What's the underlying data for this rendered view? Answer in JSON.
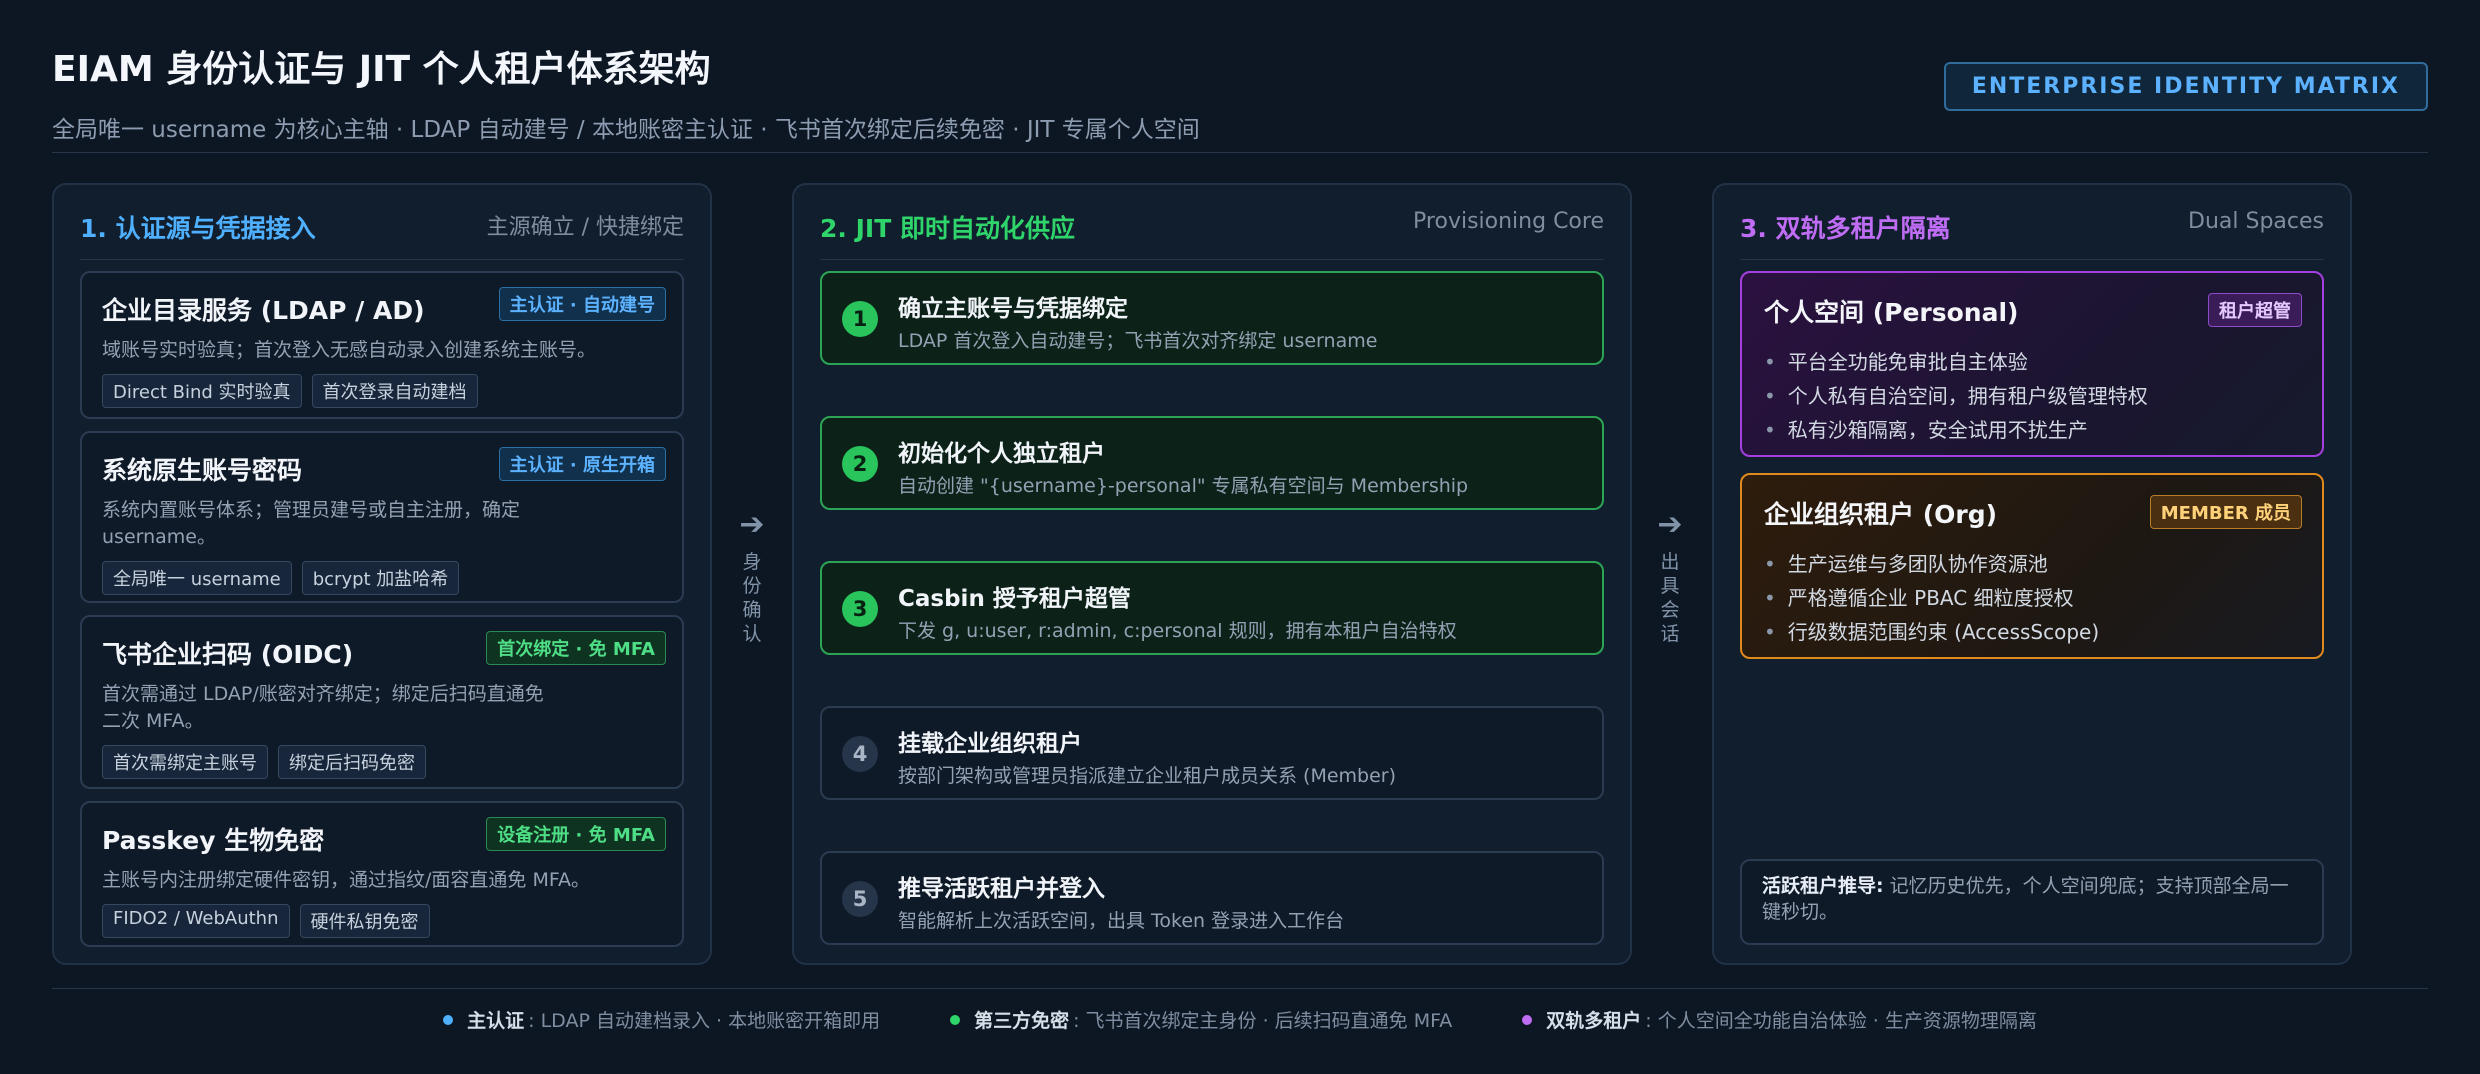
{
  "header": {
    "title": "EIAM 身份认证与 JIT 个人租户体系架构",
    "subtitle": "全局唯一 username 为核心主轴 · LDAP 自动建号 / 本地账密主认证 · 飞书首次绑定后续免密 · JIT 专属个人空间",
    "badge": "ENTERPRISE IDENTITY MATRIX"
  },
  "colors": {
    "blue": "#4fb0ff",
    "green": "#2fd56b",
    "purple": "#c06df5",
    "orange": "#e08a1e"
  },
  "col1": {
    "title": "1. 认证源与凭据接入",
    "tag": "主源确立 / 快捷绑定",
    "cards": [
      {
        "name": "企业目录服务 (LDAP / AD)",
        "badge": "主认证 · 自动建号",
        "desc": "域账号实时验真；首次登入无感自动录入创建系统主账号。",
        "chips": [
          "Direct Bind 实时验真",
          "首次登录自动建档"
        ]
      },
      {
        "name": "系统原生账号密码",
        "badge": "主认证 · 原生开箱",
        "desc": "系统内置账号体系；管理员建号或自主注册，确定 username。",
        "chips": [
          "全局唯一 username",
          "bcrypt 加盐哈希"
        ]
      },
      {
        "name": "飞书企业扫码 (OIDC)",
        "badge": "首次绑定 · 免 MFA",
        "desc": "首次需通过 LDAP/账密对齐绑定；绑定后扫码直通免二次 MFA。",
        "chips": [
          "首次需绑定主账号",
          "绑定后扫码免密"
        ]
      },
      {
        "name": "Passkey 生物免密",
        "badge": "设备注册 · 免 MFA",
        "desc": "主账号内注册绑定硬件密钥，通过指纹/面容直通免 MFA。",
        "chips": [
          "FIDO2 / WebAuthn",
          "硬件私钥免密"
        ]
      }
    ]
  },
  "arrows": {
    "a1": "身份确认",
    "a2": "出具会话"
  },
  "col2": {
    "title": "2. JIT 即时自动化供应",
    "tag": "Provisioning Core",
    "steps": [
      {
        "num": "1",
        "title": "确立主账号与凭据绑定",
        "desc": "LDAP 首次登入自动建号；飞书首次对齐绑定 username"
      },
      {
        "num": "2",
        "title": "初始化个人独立租户",
        "desc": "自动创建 \"{username}-personal\" 专属私有空间与 Membership"
      },
      {
        "num": "3",
        "title": "Casbin 授予租户超管",
        "desc": "下发 g, u:user, r:admin, c:personal 规则，拥有本租户自治特权"
      },
      {
        "num": "4",
        "title": "挂载企业组织租户",
        "desc": "按部门架构或管理员指派建立企业租户成员关系 (Member)"
      },
      {
        "num": "5",
        "title": "推导活跃租户并登入",
        "desc": "智能解析上次活跃空间，出具 Token 登录进入工作台"
      }
    ]
  },
  "col3": {
    "title": "3. 双轨多租户隔离",
    "tag": "Dual Spaces",
    "personal": {
      "name": "个人空间 (Personal)",
      "badge": "租户超管",
      "items": [
        "平台全功能免审批自主体验",
        "个人私有自治空间，拥有租户级管理特权",
        "私有沙箱隔离，安全试用不扰生产"
      ]
    },
    "org": {
      "name": "企业组织租户 (Org)",
      "badge": "MEMBER 成员",
      "items": [
        "生产运维与多团队协作资源池",
        "严格遵循企业 PBAC 细粒度授权",
        "行级数据范围约束 (AccessScope)"
      ]
    },
    "hint_label": "活跃租户推导:",
    "hint_text": "记忆历史优先，个人空间兜底；支持顶部全局一键秒切。"
  },
  "legend": [
    {
      "label": "主认证",
      "text": ": LDAP 自动建档录入 · 本地账密开箱即用",
      "color": "#4fb0ff"
    },
    {
      "label": "第三方免密",
      "text": ": 飞书首次绑定主身份 · 后续扫码直通免 MFA",
      "color": "#2fd56b"
    },
    {
      "label": "双轨多租户",
      "text": ": 个人空间全功能自治体验 · 生产资源物理隔离",
      "color": "#c06df5"
    }
  ]
}
